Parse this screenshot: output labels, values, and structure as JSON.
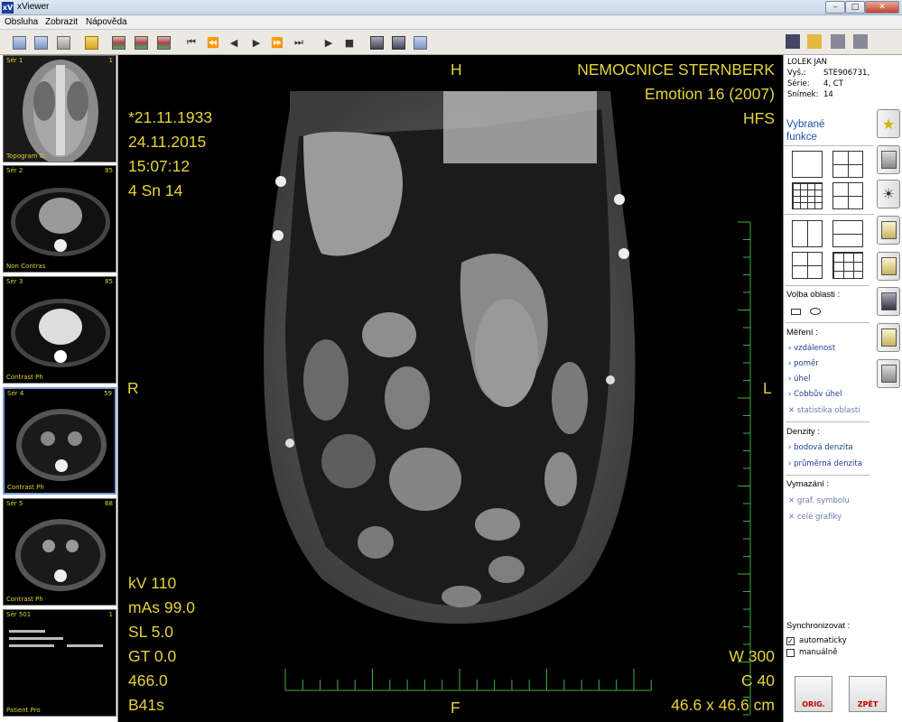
{
  "window": {
    "title": "xViewer",
    "icon_text": "xV",
    "min": "–",
    "max": "□",
    "close": "✕"
  },
  "menu": [
    "Obsluha",
    "Zobrazit",
    "Nápověda"
  ],
  "thumbnails": [
    {
      "series": "Sér 1",
      "number": "1",
      "desc": "Topogram 0."
    },
    {
      "series": "Sér 2",
      "number": "85",
      "desc": "Non Contras"
    },
    {
      "series": "Sér 3",
      "number": "85",
      "desc": "Contrast Ph"
    },
    {
      "series": "Sér 4",
      "number": "59",
      "desc": "Contrast Ph"
    },
    {
      "series": "Sér 5",
      "number": "68",
      "desc": "Contrast Ph"
    },
    {
      "series": "Sér 501",
      "number": "1",
      "desc": "Patient Pro"
    }
  ],
  "viewer": {
    "top_marker": "H",
    "bottom_marker": "F",
    "left_marker": "R",
    "right_marker": "L",
    "hospital": "NEMOCNICE STERNBERK",
    "scanner": "Emotion 16 (2007)",
    "position": "HFS",
    "birth_date": "*21.11.1933",
    "study_date": "24.11.2015",
    "study_time": "15:07:12",
    "slice_info": "4 Sn 14",
    "kv": "kV 110",
    "mas": "mAs 99.0",
    "sl": "SL 5.0",
    "gt": "GT 0.0",
    "pos_value": "466.0",
    "kernel": "B41s",
    "window_width": "W 300",
    "window_center": "C 40",
    "fov": "46.6 x 46.6 cm"
  },
  "patient": {
    "name": "LOLEK JAN",
    "exam_label": "Vyš.:",
    "exam_value": "STE906731,",
    "series_label": "Série:",
    "series_value": "4, CT",
    "image_label": "Snímek:",
    "image_value": "14"
  },
  "side": {
    "selected_functions": [
      "Vybrané",
      "funkce"
    ],
    "region_head": "Volba oblasti :",
    "measure_head": "Měření :",
    "measure_items": [
      "vzdálenost",
      "poměr",
      "úhel",
      "Cobbův úhel"
    ],
    "measure_disabled": "statistika oblasti",
    "density_head": "Denzity :",
    "density_items": [
      "bodová denzita",
      "průměrná denzita"
    ],
    "delete_head": "Vymazání :",
    "delete_items": [
      "graf. symbolu",
      "celé grafiky"
    ],
    "sync_head": "Synchronizovat :",
    "sync_auto": "automaticky",
    "sync_manual": "manuálně",
    "sync_auto_checked": true,
    "btn_orig": "ORIG.",
    "btn_back": "ZPĚT"
  },
  "colors": {
    "overlay": "#e6d23a",
    "ruler": "#3fae3f",
    "link": "#1f3f8f",
    "selected_functions": "#1f4fa8"
  }
}
